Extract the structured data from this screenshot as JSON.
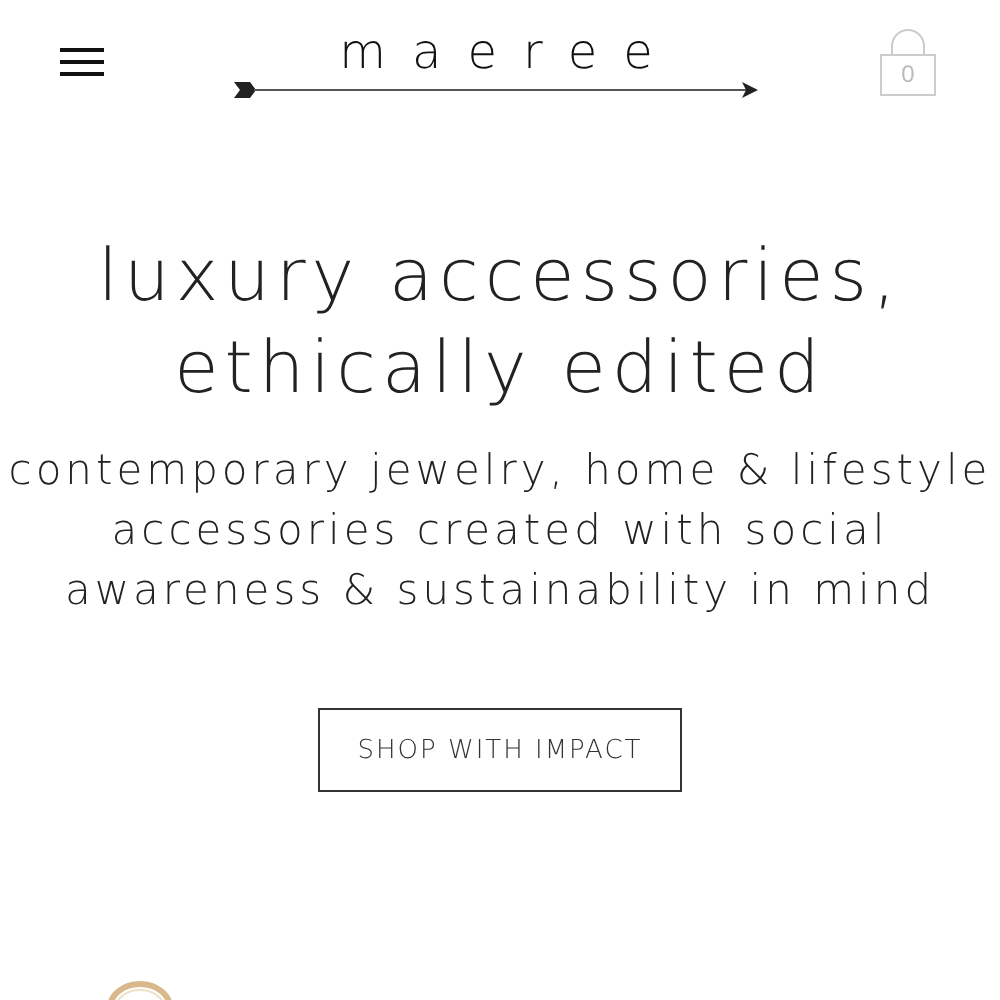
{
  "header": {
    "logo": "maeree",
    "cart_count": "0"
  },
  "hero": {
    "title_lines": [
      "luxury accessories,",
      "ethically edited"
    ],
    "subtitle_lines": [
      "contemporary jewelry, home & lifestyle",
      "accessories created with social",
      "awareness & sustainability in mind"
    ],
    "button": "SHOP WITH IMPACT"
  }
}
